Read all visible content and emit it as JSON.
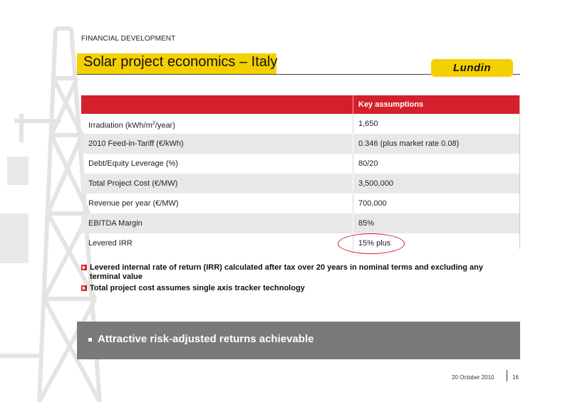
{
  "header": {
    "section_label": "FINANCIAL DEVELOPMENT",
    "title": "Solar project economics – Italy",
    "logo_text": "Lundin"
  },
  "table": {
    "column_header": "Key assumptions",
    "rows": [
      {
        "label": "Irradiation (kWh/m",
        "sup": "2",
        "label_tail": "/year)",
        "value": "1,650"
      },
      {
        "label": "2010 Feed-in-Tariff (€/kWh)",
        "value": "0.346 (plus market rate 0.08)"
      },
      {
        "label": "Debt/Equity Leverage (%)",
        "value": "80/20"
      },
      {
        "label": "Total Project Cost (€/MW)",
        "value": "3,500,000"
      },
      {
        "label": "Revenue per year (€/MW)",
        "value": "700,000"
      },
      {
        "label": "EBITDA Margin",
        "value": "85%"
      },
      {
        "label": "Levered IRR",
        "value": "15% plus"
      }
    ]
  },
  "notes": [
    "Levered internal rate of return (IRR) calculated after tax over 20 years in nominal terms and excluding any terminal value",
    "Total project cost assumes single axis tracker technology"
  ],
  "banner": {
    "text": "Attractive risk-adjusted returns achievable"
  },
  "footer": {
    "date": "20 October 2010",
    "page": "16"
  },
  "colors": {
    "accent_red": "#d3202a",
    "brand_yellow": "#f5d000",
    "banner_grey": "#7a7a7a"
  }
}
